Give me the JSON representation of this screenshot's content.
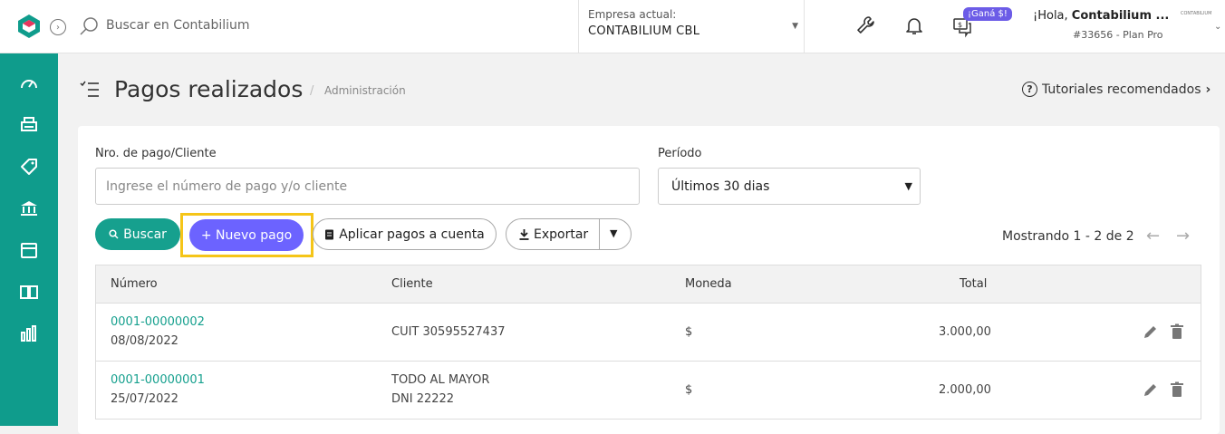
{
  "topbar": {
    "search_placeholder": "Buscar en Contabilium",
    "company_label": "Empresa actual:",
    "company_name": "CONTABILIUM CBL",
    "badge": "¡Ganá $!",
    "greeting_prefix": "¡Hola, ",
    "greeting_name": "Contabilium ...",
    "plan": "#33656 - Plan Pro",
    "mini_logo_text": "CONTABILIUM"
  },
  "sidebar": {
    "items": [
      "dashboard-icon",
      "printer-icon",
      "tag-icon",
      "bank-icon",
      "box-icon",
      "book-icon",
      "chart-icon"
    ]
  },
  "page": {
    "title": "Pagos realizados",
    "breadcrumb_sep": "/",
    "breadcrumb": "Administración",
    "tutorials": "Tutoriales recomendados"
  },
  "filters": {
    "search_label": "Nro. de pago/Cliente",
    "search_placeholder": "Ingrese el número de pago y/o cliente",
    "period_label": "Período",
    "period_value": "Últimos 30 dias"
  },
  "actions": {
    "search": "Buscar",
    "new_payment": "+ Nuevo pago",
    "apply": "Aplicar pagos a cuenta",
    "export": "Exportar"
  },
  "pagination": {
    "showing": "Mostrando 1 - 2 de 2"
  },
  "table": {
    "headers": {
      "number": "Número",
      "client": "Cliente",
      "currency": "Moneda",
      "total": "Total"
    },
    "rows": [
      {
        "number": "0001-00000002",
        "date": "08/08/2022",
        "client_line1": "CUIT 30595527437",
        "client_line2": "",
        "currency": "$",
        "total": "3.000,00"
      },
      {
        "number": "0001-00000001",
        "date": "25/07/2022",
        "client_line1": "TODO AL MAYOR",
        "client_line2": "DNI 22222",
        "currency": "$",
        "total": "2.000,00"
      }
    ]
  },
  "colors": {
    "brand": "#0f9c8c",
    "primary_button": "#6c63ff",
    "highlight": "#f5c518",
    "badge": "#6c5ce7"
  }
}
